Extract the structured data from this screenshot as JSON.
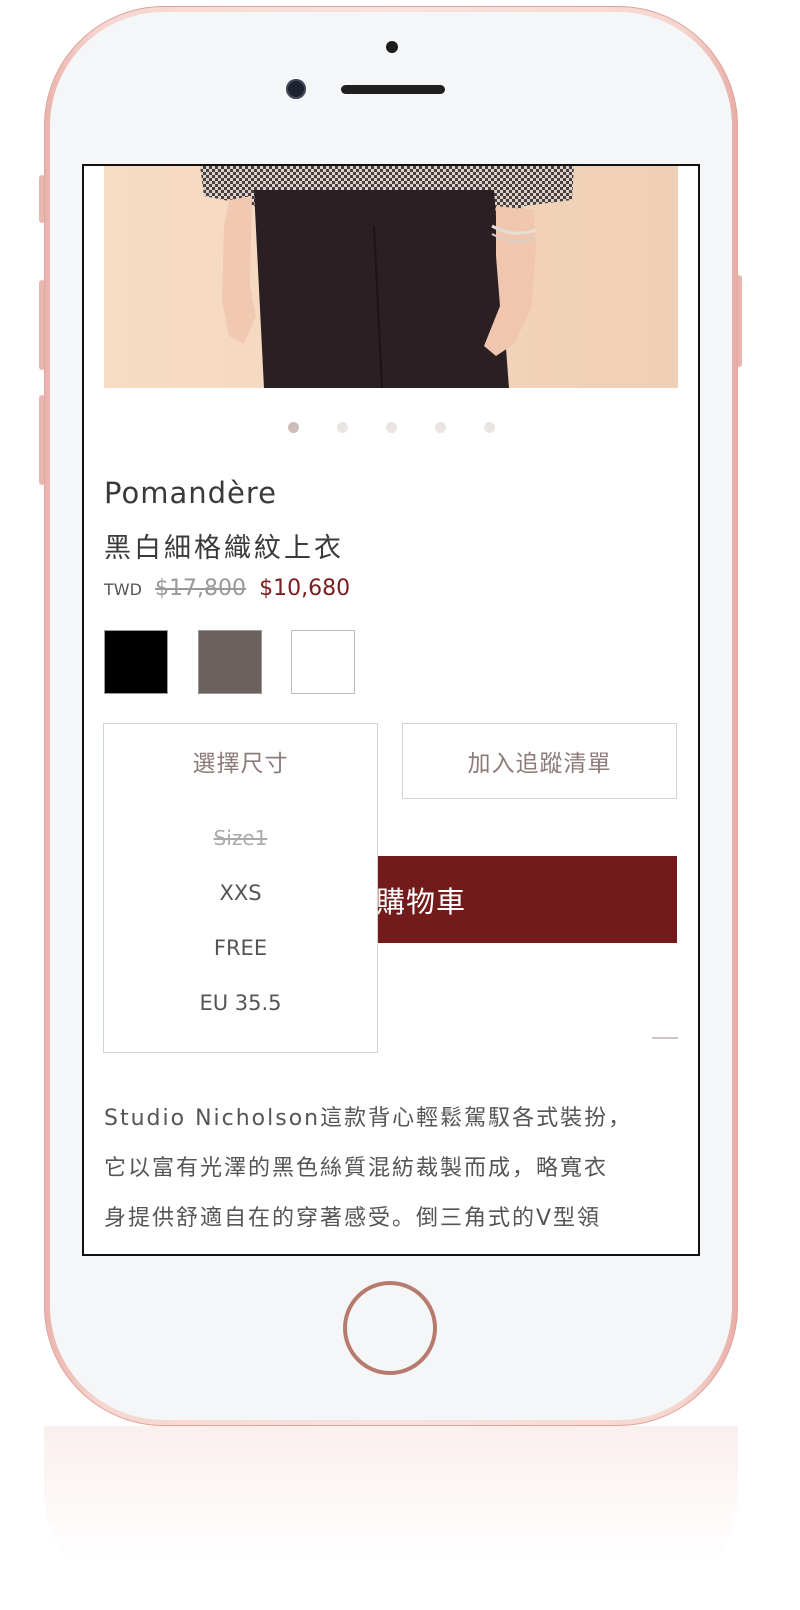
{
  "product": {
    "brand": "Pomandère",
    "name": "黑白細格織紋上衣",
    "currency": "TWD",
    "original_price": "$17,800",
    "sale_price": "$10,680",
    "image_count": 5,
    "active_image": 1
  },
  "swatches": [
    {
      "color": "#000000"
    },
    {
      "color": "#6c615d"
    },
    {
      "color": "#ffffff"
    }
  ],
  "actions": {
    "select_size_label": "選擇尺寸",
    "wishlist_label": "加入追蹤清單",
    "cart_label_visible": "購物車"
  },
  "size_dropdown": {
    "options": [
      {
        "label": "Size1",
        "available": false
      },
      {
        "label": "XXS",
        "available": true
      },
      {
        "label": "FREE",
        "available": true
      },
      {
        "label": "EU 35.5",
        "available": true
      }
    ]
  },
  "description": {
    "lines": [
      "Studio Nicholson這款背心輕鬆駕馭各式裝扮，",
      "它以富有光澤的黑色絲質混紡裁製而成，略寬衣",
      "身提供舒適自在的穿著感受。倒三角式的V型領"
    ]
  },
  "theme": {
    "accent": "#731b1a",
    "sale_price_color": "#7d1c1c",
    "phone_color": "#f6d6d1"
  }
}
